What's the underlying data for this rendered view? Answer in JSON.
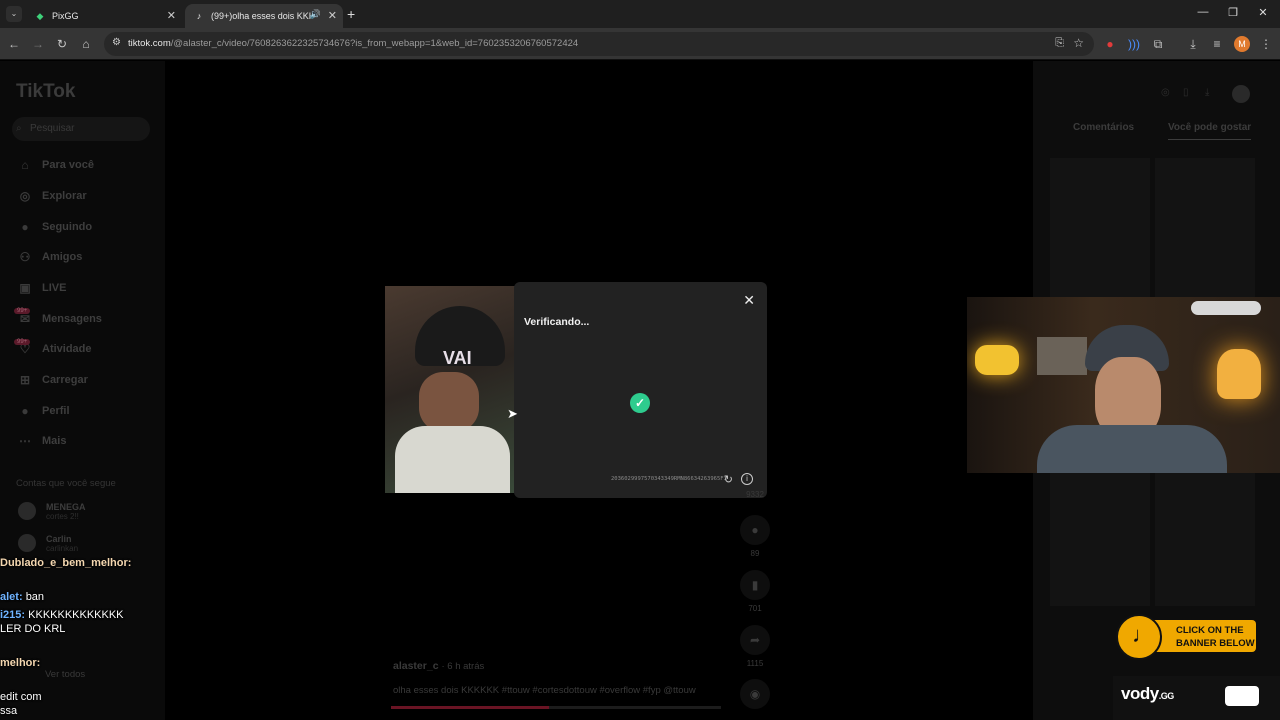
{
  "browser": {
    "tabs": [
      {
        "title": "PixGG",
        "active": false
      },
      {
        "title": "(99+)olha esses dois KKKKKK",
        "active": true
      }
    ],
    "new_tab": "+",
    "url_host": "tiktok.com",
    "url_rest": "/@alaster_c/video/7608263622325734676?is_from_webapp=1&web_id=7602353206760572424",
    "profile_initial": "M"
  },
  "tiktok": {
    "logo": "TikTok",
    "search_placeholder": "Pesquisar",
    "nav": [
      "Para você",
      "Explorar",
      "Seguindo",
      "Amigos",
      "LIVE",
      "Mensagens",
      "Atividade",
      "Carregar",
      "Perfil",
      "Mais"
    ],
    "badge": "99+",
    "following_heading": "Contas que você segue",
    "accounts": [
      {
        "name": "MENEGA",
        "sub": "cortes 2!!"
      },
      {
        "name": "Carlin",
        "sub": "carlinkan"
      }
    ],
    "see_all": "Ver todos",
    "right_tabs": [
      "Comentários",
      "Você pode gostar"
    ],
    "actions": [
      {
        "icon": "heart",
        "count": "9332"
      },
      {
        "icon": "comment",
        "count": "89"
      },
      {
        "icon": "bookmark",
        "count": "701"
      },
      {
        "icon": "share",
        "count": "1115"
      }
    ],
    "author": "alaster_c",
    "time": "· 6 h atrás",
    "caption": "olha esses dois KKKKKK #ttouw #cortesdottouw #overflow #fyp @ttouw",
    "video_overlay_text": "VAI"
  },
  "dialog": {
    "title": "Verificando...",
    "code": "2036029997570343349RMN86634263965F3"
  },
  "chat": [
    {
      "user": "Dublado_e_bem_melhor:",
      "msg": "",
      "color": "#f4d7b0"
    },
    {
      "user": "alet:",
      "msg": "ban",
      "color": "#6fb3ff"
    },
    {
      "user": "i215:",
      "msg": "KKKKKKKKKKKKK",
      "color": "#6fb3ff"
    },
    {
      "user": "",
      "msg": "LER DO KRL",
      "color": "#fff"
    },
    {
      "user": "melhor:",
      "msg": "",
      "color": "#f4d7b0"
    },
    {
      "user": "",
      "msg": "edit com",
      "color": "#fff"
    },
    {
      "user": "",
      "msg": "ssa",
      "color": "#fff"
    }
  ],
  "banner": {
    "line1": "CLICK ON THE",
    "line2": "BANNER BELOW",
    "brand": "vody",
    "brand_suffix": ".GG"
  }
}
